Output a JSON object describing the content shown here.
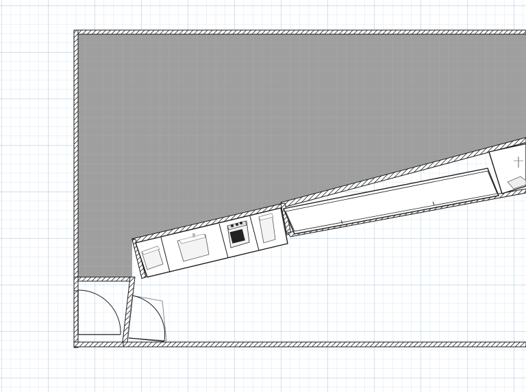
{
  "app": {
    "view": "floor-plan-2d"
  },
  "colors": {
    "grid_background": "#ffffff",
    "grid_major": "#9ec3e0",
    "grid_minor": "#d3e6f4",
    "room_fill": "#9a9a9a",
    "wall_fill": "#ffffff",
    "wall_hatch": "#1a1a1a",
    "furniture_fill": "#f2f2f2",
    "furniture_stroke": "#333333"
  },
  "furniture": [
    {
      "name": "door-opening-left",
      "type": "door",
      "icon": "door-icon"
    },
    {
      "name": "door-opening-right",
      "type": "door",
      "icon": "door-icon"
    },
    {
      "name": "kitchen-cabinet",
      "type": "cabinet",
      "icon": "cabinet-icon"
    },
    {
      "name": "kitchen-sink",
      "type": "sink",
      "icon": "sink-icon"
    },
    {
      "name": "cooktop-oven",
      "type": "stove",
      "icon": "stove-icon"
    },
    {
      "name": "refrigerator",
      "type": "fridge",
      "icon": "fridge-icon"
    },
    {
      "name": "bench-counter",
      "type": "counter",
      "icon": "counter-icon"
    },
    {
      "name": "side-cabinet",
      "type": "cabinet",
      "icon": "cabinet-icon"
    }
  ]
}
